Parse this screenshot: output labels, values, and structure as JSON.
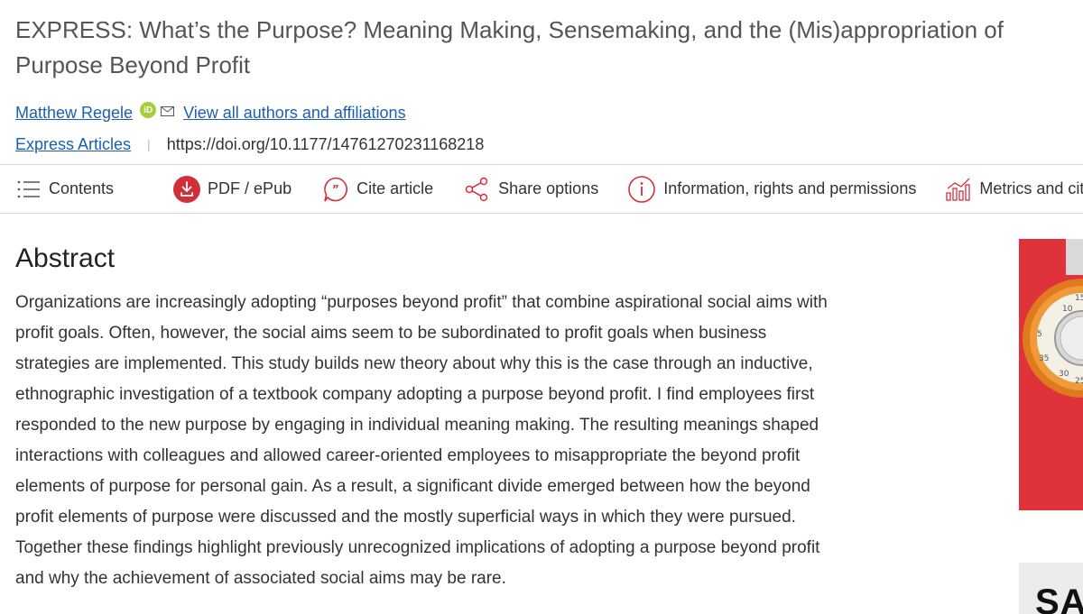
{
  "article": {
    "title": "EXPRESS: What’s the Purpose? Meaning Making, Sensemaking, and the (Mis)appropriation of Purpose Beyond Profit",
    "author": "Matthew Regele",
    "orcid_label": "iD",
    "view_authors": "View all authors and affiliations",
    "section": "Express Articles",
    "doi": "https://doi.org/10.1177/14761270231168218"
  },
  "toolbar": {
    "contents": "Contents",
    "pdf": "PDF / ePub",
    "cite": "Cite article",
    "share": "Share options",
    "info": "Information, rights and permissions",
    "metrics": "Metrics and citations"
  },
  "abstract": {
    "heading": "Abstract",
    "lines": [
      "Organizations are increasingly adopting “purposes beyond profit” that combine aspirational social aims with",
      "profit goals. Often, however, the social aims seem to be subordinated to profit goals when business",
      "strategies are implemented. This study builds new theory about why this is the case through an inductive,",
      "ethnographic investigation of a textbook company adopting a purpose beyond profit. I find employees first",
      "responded to the new purpose by engaging in individual meaning making. The resulting meanings shaped",
      "interactions with colleagues and allowed career-oriented employees to misappropriate the beyond profit",
      "elements of purpose for personal gain. As a result, a significant divide emerged between how the beyond",
      "profit elements of purpose were discussed and the mostly superficial ways in which they were pursued.",
      "Together these findings highlight previously unrecognized implications of adopting a purpose beyond profit",
      "and why the achievement of associated social aims may be rare."
    ]
  },
  "ads": {
    "dial_numbers": [
      "10",
      "15",
      "5",
      "30",
      "25",
      "35"
    ],
    "gray_text": "SA"
  },
  "colors": {
    "link": "#1a5fb4",
    "pdf_red": "#d0303a",
    "cite_red": "#d0303a",
    "orcid_green": "#a6ce39",
    "ad_red": "#e0323a"
  },
  "icons": [
    "list-icon",
    "download-icon",
    "quote-icon",
    "share-icon",
    "info-icon",
    "metrics-icon",
    "mail-icon",
    "orcid-icon"
  ]
}
